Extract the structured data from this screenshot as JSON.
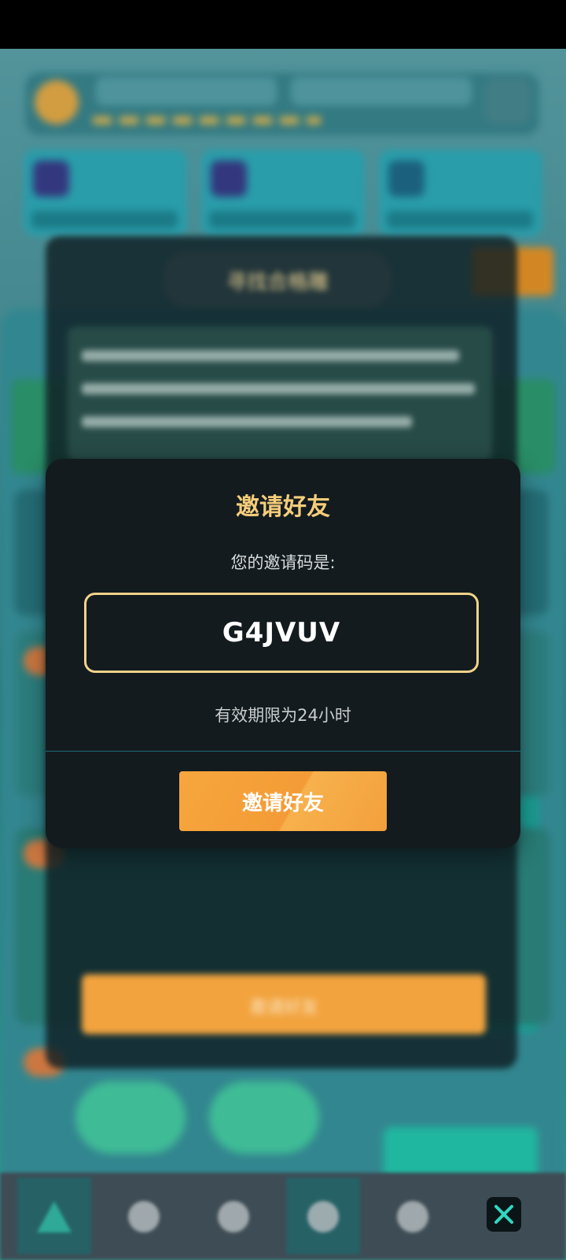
{
  "background_game": {
    "under_dialog_title": "寻找合格雕",
    "under_dialog_button": "邀请好友"
  },
  "invite_dialog": {
    "title": "邀请好友",
    "code_label": "您的邀请码是:",
    "invite_code": "G4JVUV",
    "validity": "有效期限为24小时",
    "button_label": "邀请好友"
  },
  "bottom_nav": {
    "items": [
      "home-icon",
      "bag-icon",
      "settings-icon",
      "diamond-icon",
      "heart-icon",
      "close-icon"
    ]
  },
  "colors": {
    "dialog_bg": "#131b1f",
    "title_gold": "#f5cd7a",
    "code_border": "#f1d389",
    "button_orange": "#f7a63d",
    "close_accent": "#2fd8c0"
  }
}
